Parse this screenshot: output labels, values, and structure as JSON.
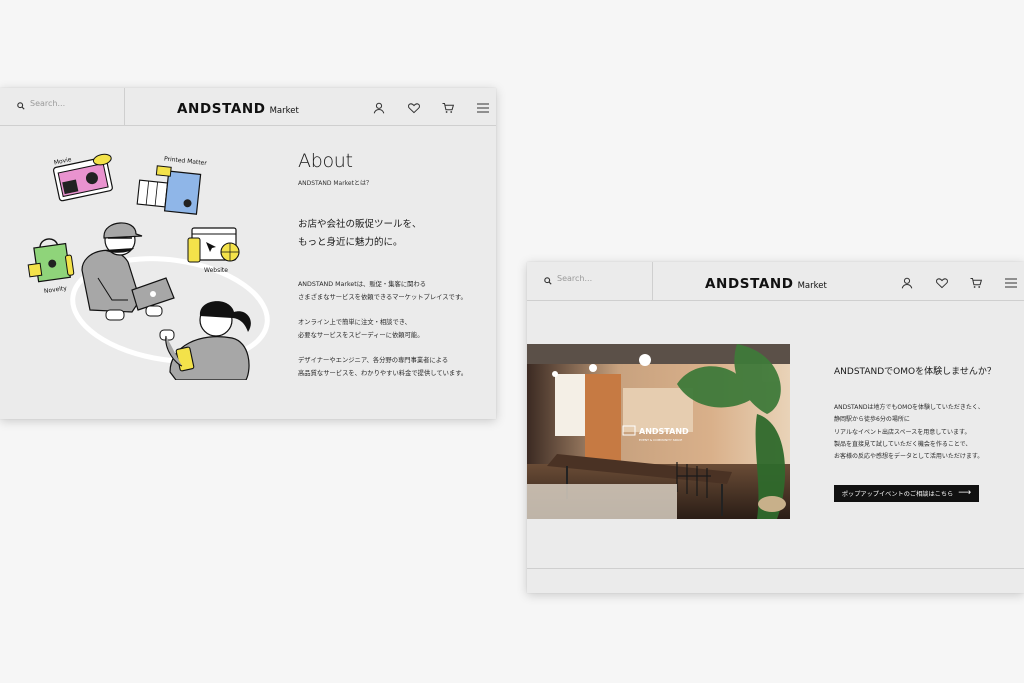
{
  "brand": {
    "name": "ANDSTAND",
    "suffix": "Market"
  },
  "search": {
    "placeholder": "Search..."
  },
  "header_icons": [
    "user-icon",
    "heart-icon",
    "cart-icon",
    "menu-icon"
  ],
  "about": {
    "title": "About",
    "subtitle": "ANDSTAND Marketとは？",
    "lead": [
      "お店や会社の販促ツールを、",
      "もっと身近に魅力的に。"
    ],
    "paragraph_1": [
      "ANDSTAND Marketは、販促・集客に関わる",
      "さまざまなサービスを依頼できるマーケットプレイスです。"
    ],
    "paragraph_2": [
      "オンライン上で簡単に注文・相談でき、",
      "必要なサービスをスピーディーに依頼可能。"
    ],
    "paragraph_3": [
      "デザイナーやエンジニア、各分野の専門事業者による",
      "高品質なサービスを、わかりやすい料金で提供しています。"
    ],
    "illustration_labels": {
      "movie": "Movie",
      "printed": "Printed Matter",
      "novelty": "Novelty",
      "website": "Website"
    }
  },
  "omo": {
    "title": "ANDSTANDでOMOを体験しませんか？",
    "body": [
      "ANDSTANDは地方でもOMOを体験していただきたく、",
      "静岡駅から徒歩6分の場所に",
      "リアルなイベント出店スペースを用意しています。",
      "製品を直接見て試していただく機会を作ることで、",
      "お客様の反応や感想をデータとして活用いただけます。"
    ],
    "cta": "ポップアップイベントのご相談はこちら",
    "photo_sign": "ANDSTAND",
    "photo_sign_sub": "EVENT & COMMUNITY SPACE"
  },
  "colors": {
    "card_bg": "#ebebeb",
    "page_bg": "#f6f6f6",
    "cta_bg": "#111111",
    "accent_yellow": "#f3e24a",
    "accent_pink": "#e993cf",
    "accent_green": "#8fd47a",
    "accent_blue": "#8fb6e8"
  }
}
